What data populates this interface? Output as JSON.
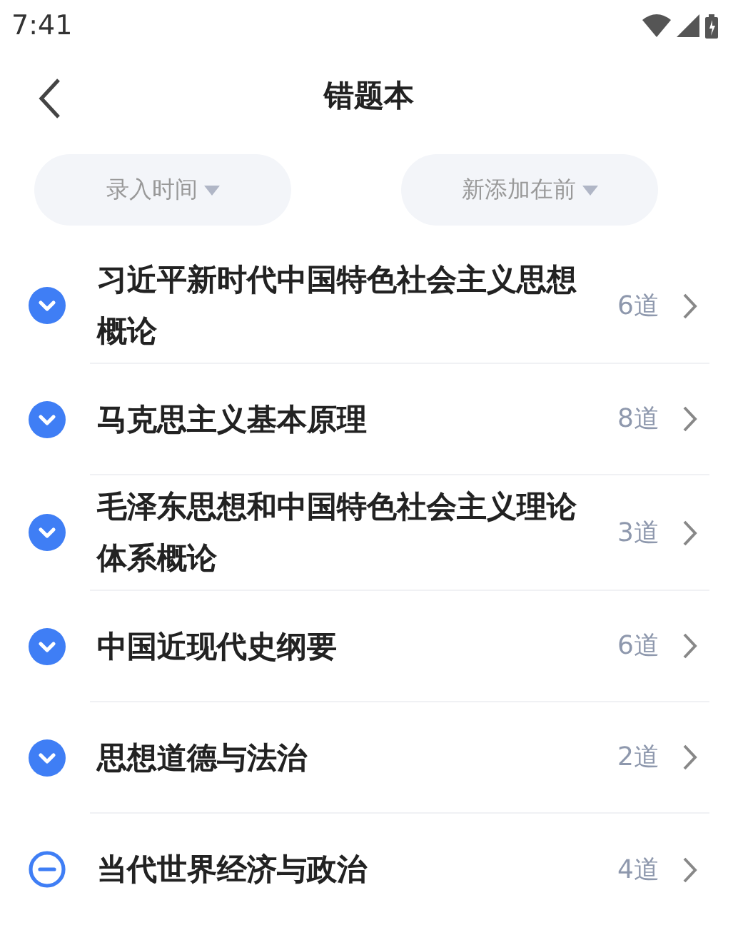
{
  "status_bar": {
    "time": "7:41"
  },
  "header": {
    "title": "错题本"
  },
  "filters": [
    {
      "label": "录入时间"
    },
    {
      "label": "新添加在前"
    }
  ],
  "subjects": [
    {
      "name": "习近平新时代中国特色社会主义思想概论",
      "count": "6道",
      "kind": "chevron"
    },
    {
      "name": "马克思主义基本原理",
      "count": "8道",
      "kind": "chevron"
    },
    {
      "name": "毛泽东思想和中国特色社会主义理论体系概论",
      "count": "3道",
      "kind": "chevron"
    },
    {
      "name": "中国近现代史纲要",
      "count": "6道",
      "kind": "chevron"
    },
    {
      "name": "思想道德与法治",
      "count": "2道",
      "kind": "chevron"
    },
    {
      "name": "当代世界经济与政治",
      "count": "4道",
      "kind": "minus"
    }
  ]
}
